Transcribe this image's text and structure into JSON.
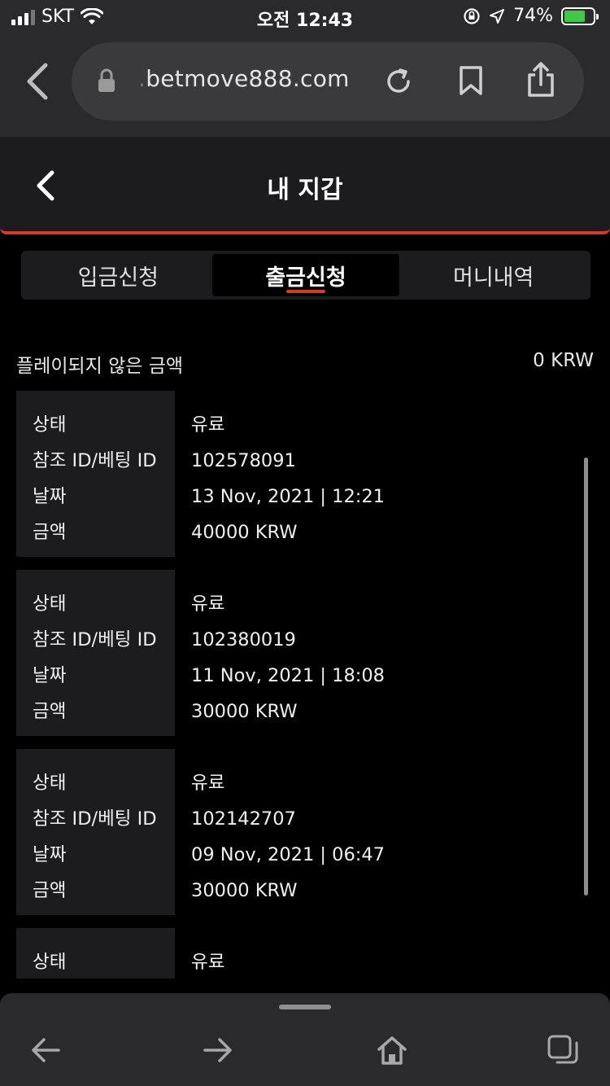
{
  "status_bar": {
    "carrier": "SKT",
    "time": "오전 12:43",
    "battery": "74%",
    "battery_level": 0.74
  },
  "browser": {
    "url_faded": ".",
    "url": "betmove888.com"
  },
  "app": {
    "title": "내 지갑"
  },
  "tabs": [
    {
      "label": "입금신청",
      "active": false
    },
    {
      "label": "출금신청",
      "active": true
    },
    {
      "label": "머니내역",
      "active": false
    }
  ],
  "balance": {
    "label": "플레이되지 않은 금액",
    "value": "0 KRW"
  },
  "field_labels": {
    "status": "상태",
    "ref_id": "참조 ID/베팅 ID",
    "date": "날짜",
    "amount": "금액"
  },
  "records": [
    {
      "status": "유료",
      "ref_id": "102578091",
      "date": "13 Nov, 2021 | 12:21",
      "amount": "40000 KRW"
    },
    {
      "status": "유료",
      "ref_id": "102380019",
      "date": "11 Nov, 2021 | 18:08",
      "amount": "30000 KRW"
    },
    {
      "status": "유료",
      "ref_id": "102142707",
      "date": "09 Nov, 2021 | 06:47",
      "amount": "30000 KRW"
    },
    {
      "status": "유료",
      "ref_id": "",
      "date": "",
      "amount": ""
    }
  ],
  "colors": {
    "accent": "#d8392f",
    "background": "#000000",
    "panel": "#1c1c1e",
    "browser_chrome": "#2a2a2c"
  }
}
